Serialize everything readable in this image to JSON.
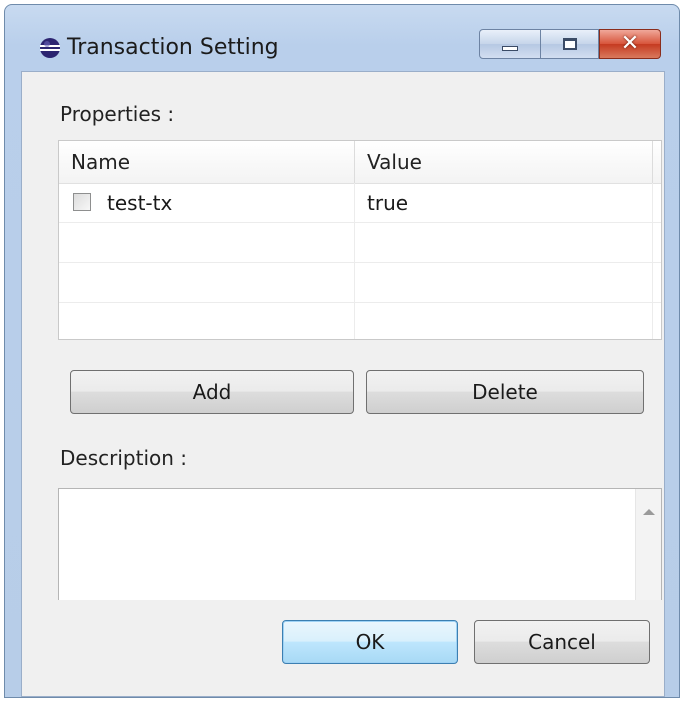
{
  "window": {
    "title": "Transaction Setting",
    "icon": "eclipse-globe-icon"
  },
  "properties": {
    "label": "Properties :",
    "columns": [
      "Name",
      "Value"
    ],
    "rows": [
      {
        "checked": false,
        "name": "test-tx",
        "value": "true"
      },
      {
        "name": "",
        "value": ""
      },
      {
        "name": "",
        "value": ""
      },
      {
        "name": "",
        "value": ""
      }
    ]
  },
  "buttons": {
    "add": "Add",
    "delete": "Delete",
    "ok": "OK",
    "cancel": "Cancel"
  },
  "description": {
    "label": "Description :",
    "value": ""
  },
  "colors": {
    "frame": "#b9cfeb",
    "close_button": "#c53a20",
    "default_button": "#bee6fd"
  }
}
